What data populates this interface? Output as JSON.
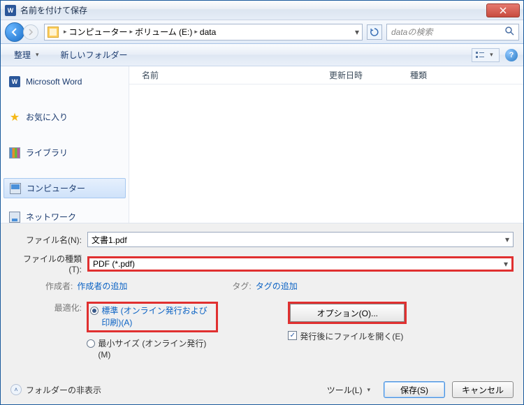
{
  "title": "名前を付けて保存",
  "breadcrumb": {
    "seg1": "コンピューター",
    "seg2": "ボリューム (E:)",
    "seg3": "data"
  },
  "search": {
    "placeholder": "dataの検索"
  },
  "toolbar": {
    "organize": "整理",
    "new_folder": "新しいフォルダー"
  },
  "sidebar": {
    "word": "Microsoft Word",
    "fav": "お気に入り",
    "lib": "ライブラリ",
    "comp": "コンピューター",
    "net": "ネットワーク"
  },
  "columns": {
    "name": "名前",
    "date": "更新日時",
    "type": "種類"
  },
  "fields": {
    "filename_label": "ファイル名(N):",
    "filename_value": "文書1.pdf",
    "filetype_label": "ファイルの種類(T):",
    "filetype_value": "PDF (*.pdf)"
  },
  "meta": {
    "author_label": "作成者:",
    "author_link": "作成者の追加",
    "tag_label": "タグ:",
    "tag_link": "タグの追加"
  },
  "optimize": {
    "label": "最適化:",
    "standard": "標準 (オンライン発行および印刷)(A)",
    "minimum": "最小サイズ (オンライン発行)(M)"
  },
  "options_btn": "オプション(O)...",
  "open_after": "発行後にファイルを開く(E)",
  "footer": {
    "hide_folders": "フォルダーの非表示",
    "tools": "ツール(L)",
    "save": "保存(S)",
    "cancel": "キャンセル"
  }
}
